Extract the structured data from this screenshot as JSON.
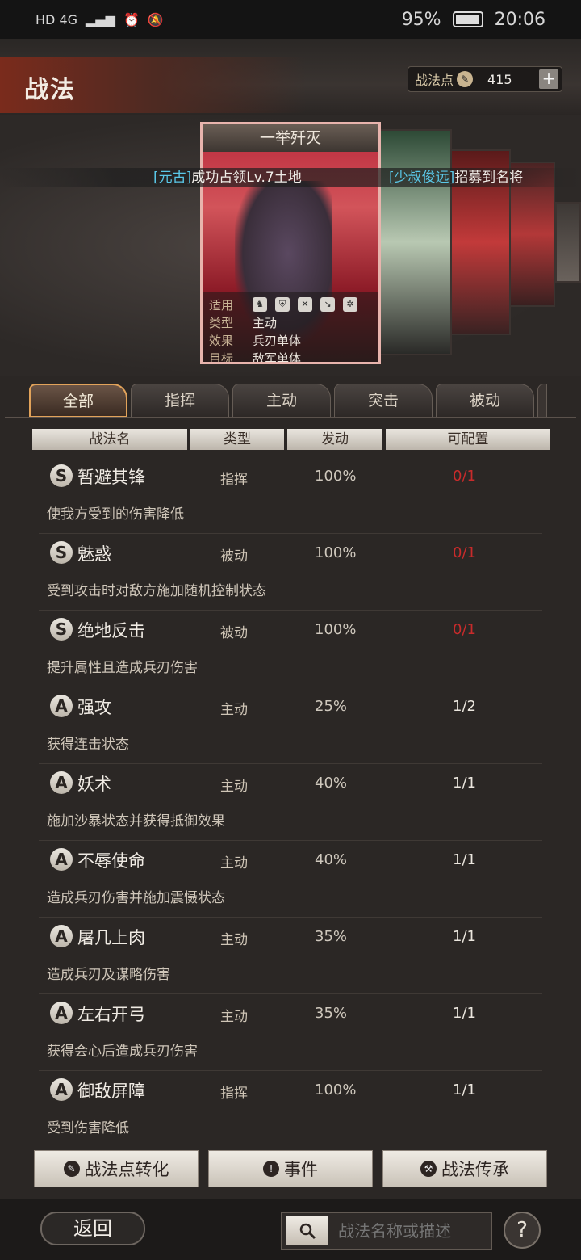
{
  "status_bar": {
    "signal": "HD 4G",
    "battery": "95%",
    "time": "20:06"
  },
  "header": {
    "title": "战法",
    "points_label": "战法点",
    "points_value": "415",
    "plus_label": "+"
  },
  "ticker": {
    "msg1_tag": "[元古]",
    "msg1_text": "成功占领Lv.7土地",
    "msg2_tag": "[少叔俊远]",
    "msg2_text": "招募到名将"
  },
  "card": {
    "title": "一举歼灭",
    "applicable_label": "适用",
    "type_label": "类型",
    "type_value": "主动",
    "effect_label": "效果",
    "effect_value": "兵刃单体",
    "target_label": "目标",
    "target_value": "敌军单体"
  },
  "tabs": [
    "全部",
    "指挥",
    "主动",
    "突击",
    "被动"
  ],
  "columns": [
    "战法名",
    "类型",
    "发动",
    "可配置"
  ],
  "rows": [
    {
      "grade": "S",
      "name": "暂避其锋",
      "type": "指挥",
      "rate": "100%",
      "config": "0/1",
      "desc": "使我方受到的伤害降低"
    },
    {
      "grade": "S",
      "name": "魅惑",
      "type": "被动",
      "rate": "100%",
      "config": "0/1",
      "desc": "受到攻击时对敌方施加随机控制状态"
    },
    {
      "grade": "S",
      "name": "绝地反击",
      "type": "被动",
      "rate": "100%",
      "config": "0/1",
      "desc": "提升属性且造成兵刃伤害"
    },
    {
      "grade": "A",
      "name": "强攻",
      "type": "主动",
      "rate": "25%",
      "config": "1/2",
      "desc": "获得连击状态"
    },
    {
      "grade": "A",
      "name": "妖术",
      "type": "主动",
      "rate": "40%",
      "config": "1/1",
      "desc": "施加沙暴状态并获得抵御效果"
    },
    {
      "grade": "A",
      "name": "不辱使命",
      "type": "主动",
      "rate": "40%",
      "config": "1/1",
      "desc": "造成兵刃伤害并施加震慑状态"
    },
    {
      "grade": "A",
      "name": "屠几上肉",
      "type": "主动",
      "rate": "35%",
      "config": "1/1",
      "desc": "造成兵刃及谋略伤害"
    },
    {
      "grade": "A",
      "name": "左右开弓",
      "type": "主动",
      "rate": "35%",
      "config": "1/1",
      "desc": "获得会心后造成兵刃伤害"
    },
    {
      "grade": "A",
      "name": "御敌屏障",
      "type": "指挥",
      "rate": "100%",
      "config": "1/1",
      "desc": "受到伤害降低"
    }
  ],
  "actions": {
    "convert": "战法点转化",
    "events": "事件",
    "inherit": "战法传承"
  },
  "footer": {
    "back": "返回",
    "search_placeholder": "战法名称或描述",
    "help": "?"
  },
  "colors": {
    "accent_red": "#c82b2b",
    "ticker_blue": "#5ac8e8",
    "tab_active_border": "#e2a35a"
  }
}
